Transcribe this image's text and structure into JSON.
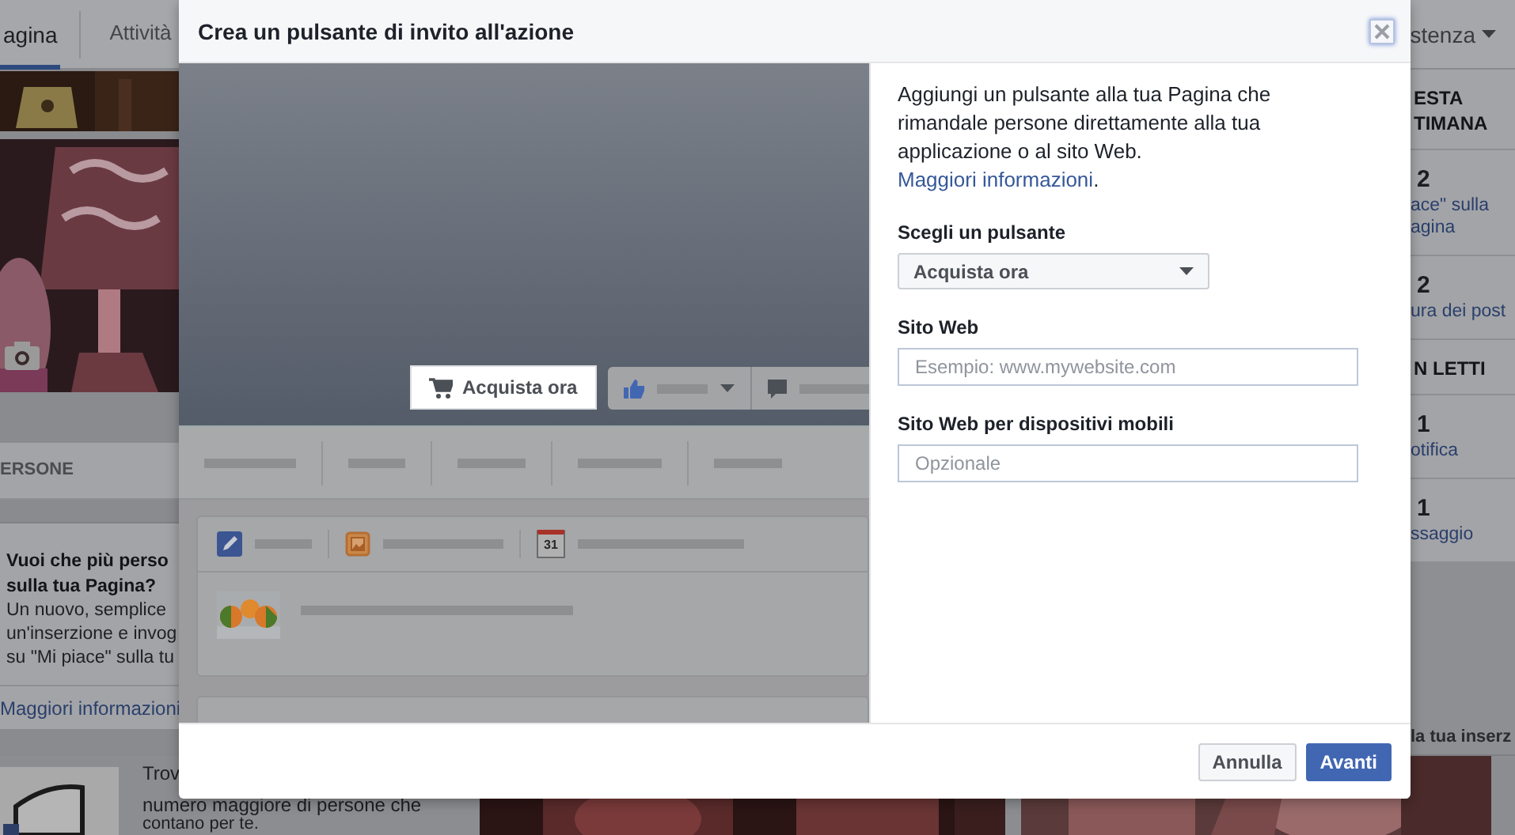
{
  "page_nav": {
    "tabs": [
      {
        "label": "agina",
        "selected": true
      },
      {
        "label": "Attività",
        "selected": false
      }
    ],
    "menu": "stenza"
  },
  "left_column": {
    "section_title": "ERSONE",
    "promo": {
      "title_lines": [
        "Vuoi che più perso",
        "sulla tua Pagina?"
      ],
      "body_lines": [
        "Un nuovo, semplice",
        "un'inserzione e invog",
        "su \"Mi piace\" sulla tu"
      ],
      "link": "Maggiori informazioni"
    },
    "promo2_lines": [
      "Trov",
      "numero maggiore di persone che",
      "contano per te."
    ]
  },
  "right_column": {
    "sections": [
      {
        "title_lines": [
          "ESTA",
          "TIMANA"
        ],
        "stats": [
          {
            "value": "2",
            "label_lines": [
              "ace\" sulla",
              "agina"
            ]
          },
          {
            "value": "2",
            "label_lines": [
              "ura dei post"
            ]
          }
        ]
      },
      {
        "title_lines": [
          "N LETTI"
        ],
        "stats": [
          {
            "value": "1",
            "label_lines": [
              "otifica"
            ]
          },
          {
            "value": "1",
            "label_lines": [
              "ssaggio"
            ]
          }
        ]
      }
    ],
    "footer": "la tua inserz"
  },
  "dialog": {
    "title": "Crea un pulsante di invito all'azione",
    "preview": {
      "cta_button": "Acquista ora",
      "calendar_day": "31"
    },
    "intro": {
      "text": "Aggiungi un pulsante alla tua Pagina che rimandale persone direttamente alla tua applicazione o al sito Web.",
      "link": "Maggiori informazioni",
      "after": "."
    },
    "fields": [
      {
        "kind": "select",
        "label": "Scegli un pulsante",
        "value": "Acquista ora"
      },
      {
        "kind": "input",
        "label": "Sito Web",
        "placeholder": "Esempio: www.mywebsite.com"
      },
      {
        "kind": "input",
        "label": "Sito Web per dispositivi mobili",
        "placeholder": "Opzionale"
      }
    ],
    "buttons": [
      {
        "label": "Annulla",
        "primary": false
      },
      {
        "label": "Avanti",
        "primary": true
      }
    ]
  }
}
